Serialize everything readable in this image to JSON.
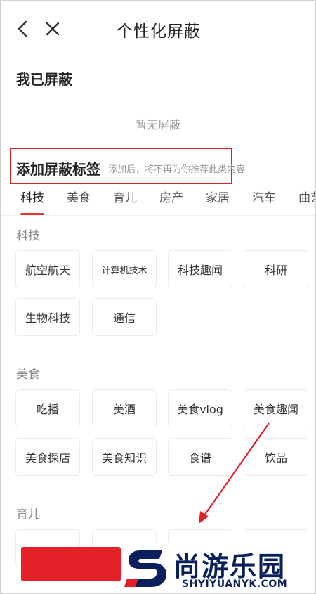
{
  "header": {
    "title": "个性化屏蔽",
    "back_icon": "chevron-left-icon",
    "close_icon": "close-icon"
  },
  "blocked": {
    "title": "我已屏蔽",
    "empty": "暂无屏蔽"
  },
  "add": {
    "title": "添加屏蔽标签",
    "subtitle": "添加后，将不再为你推荐此类内容",
    "highlight_color": "#e21f26"
  },
  "tabs": [
    "科技",
    "美食",
    "育儿",
    "房产",
    "家居",
    "汽车",
    "曲艺"
  ],
  "active_tab": "科技",
  "categories": [
    {
      "name": "科技",
      "tags": [
        "航空航天",
        "计算机技术",
        "科技趣闻",
        "科研",
        "生物科技",
        "通信"
      ]
    },
    {
      "name": "美食",
      "tags": [
        "吃播",
        "美酒",
        "美食vlog",
        "美食趣闻",
        "美食探店",
        "美食知识",
        "食谱",
        "饮品"
      ]
    },
    {
      "name": "育儿"
    }
  ],
  "watermark": {
    "brand": "尚游乐园",
    "url": "SHYIYUANYK.COM"
  },
  "colors": {
    "accent": "#e0373d",
    "button": "#e62129",
    "annotation": "#e21f26",
    "brand": "#0b1f5c"
  }
}
